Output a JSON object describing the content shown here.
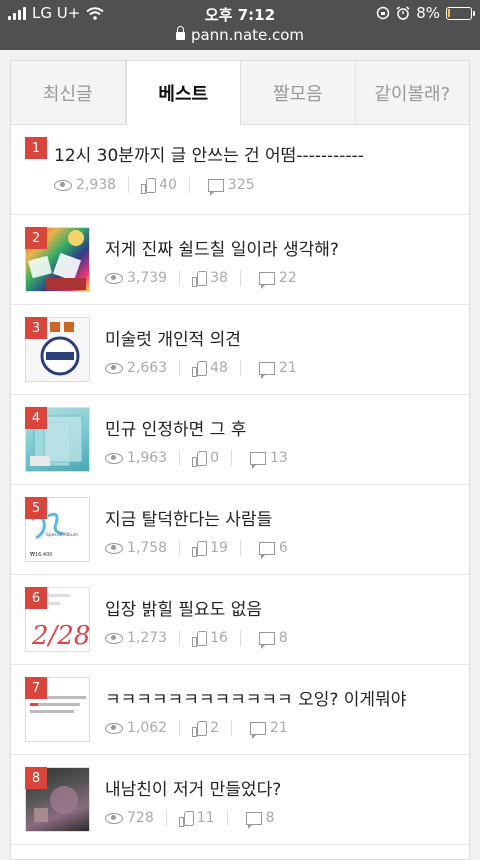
{
  "status": {
    "carrier": "LG U+",
    "time": "오후 7:12",
    "battery": "8%",
    "battery_level": 0.08,
    "url": "pann.nate.com"
  },
  "tabs": [
    {
      "label": "최신글",
      "active": false
    },
    {
      "label": "베스트",
      "active": true
    },
    {
      "label": "짤모음",
      "active": false
    },
    {
      "label": "같이볼래?",
      "active": false
    }
  ],
  "items": [
    {
      "rank": "1",
      "title": "12시 30분까지 글 안쓰는 건 어떰-----------",
      "views": "2,938",
      "likes": "40",
      "comments": "325",
      "thumb": null
    },
    {
      "rank": "2",
      "title": "저게 진짜 쉴드칠 일이라 생각해?",
      "views": "3,739",
      "likes": "38",
      "comments": "22",
      "thumb": "collage"
    },
    {
      "rank": "3",
      "title": "미술럿 개인적 의견",
      "views": "2,663",
      "likes": "48",
      "comments": "21",
      "thumb": "seal"
    },
    {
      "rank": "4",
      "title": "민규 인정하면 그 후",
      "views": "1,963",
      "likes": "0",
      "comments": "13",
      "thumb": "folders"
    },
    {
      "rank": "5",
      "title": "지금 탈덕한다는 사람들",
      "views": "1,758",
      "likes": "19",
      "comments": "6",
      "thumb": "album",
      "thumb_text": [
        "Special Album",
        "₩16,400"
      ]
    },
    {
      "rank": "6",
      "title": "입장 밝힐 필요도 없음",
      "views": "1,273",
      "likes": "16",
      "comments": "8",
      "thumb": "handwriting",
      "thumb_text": [
        "2/28"
      ]
    },
    {
      "rank": "7",
      "title": "ㅋㅋㅋㅋㅋㅋㅋㅋㅋㅋㅋㅋ 오잉? 이게뭐야",
      "views": "1,062",
      "likes": "2",
      "comments": "21",
      "thumb": "text-capture"
    },
    {
      "rank": "8",
      "title": "내남친이 저거 만들었다?",
      "views": "728",
      "likes": "11",
      "comments": "8",
      "thumb": "dark-photo"
    }
  ]
}
